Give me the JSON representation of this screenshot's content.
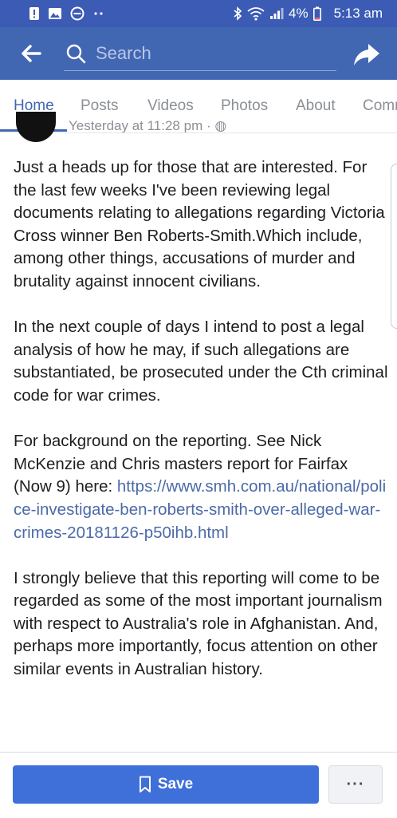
{
  "status_bar": {
    "battery_percent": "4%",
    "time": "5:13 am",
    "icons": [
      "alert-icon",
      "image-icon",
      "do-not-disturb-icon",
      "more-dots-icon",
      "bluetooth-icon",
      "wifi-icon",
      "signal-icon",
      "battery-icon"
    ]
  },
  "header": {
    "search_placeholder": "Search",
    "back_icon": "arrow-back-icon",
    "share_icon": "share-icon"
  },
  "tabs": [
    {
      "label": "Home",
      "active": true
    },
    {
      "label": "Posts",
      "active": false
    },
    {
      "label": "Videos",
      "active": false
    },
    {
      "label": "Photos",
      "active": false
    },
    {
      "label": "About",
      "active": false
    },
    {
      "label": "Community",
      "active": false
    }
  ],
  "post": {
    "meta": "Yesterday at 11:28 pm ·",
    "paragraphs": [
      "Just a heads up for those that are interested. For the last few weeks I've been reviewing legal documents relating to allegations regarding Victoria Cross winner Ben Roberts-Smith.Which include, among other things, accusations of murder and brutality against innocent civilians.",
      "In the next couple of days I intend to post a legal analysis of how he may, if such allegations are substantiated, be prosecuted under the Cth criminal code for war crimes.",
      "For background on the reporting. See Nick McKenzie and Chris masters report for Fairfax (Now 9) here:"
    ],
    "link": "https://www.smh.com.au/national/police-investigate-ben-roberts-smith-over-alleged-war-crimes-20181126-p50ihb.html",
    "closing": "I strongly believe that this reporting will come to be regarded as some of the most important journalism with respect to Australia's role in Afghanistan. And, perhaps more importantly, focus attention on other similar events in Australian history."
  },
  "bottom_bar": {
    "save_label": "Save",
    "more_label": "···"
  },
  "colors": {
    "header_blue": "#4267b2",
    "status_blue": "#3b5bb5",
    "save_blue": "#3f6fd8",
    "link_blue": "#4b6aa8"
  }
}
